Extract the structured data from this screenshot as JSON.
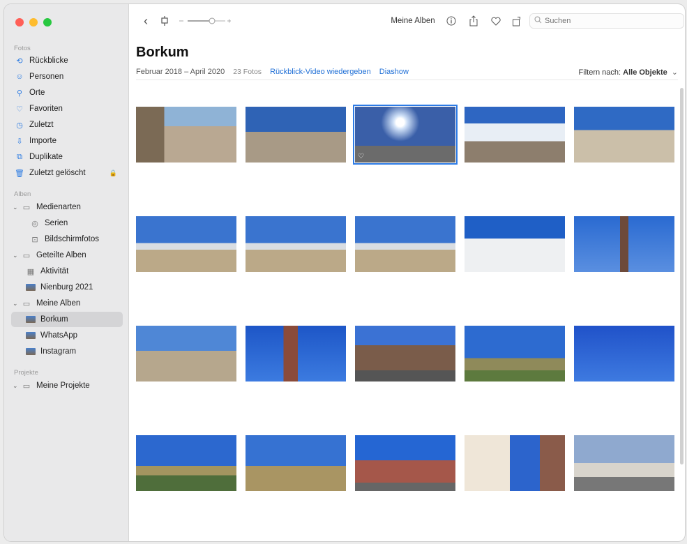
{
  "sidebar": {
    "sections": {
      "fotos": "Fotos",
      "alben": "Alben",
      "projekte": "Projekte"
    },
    "fotos_items": [
      {
        "label": "Rückblicke",
        "icon": "memories-icon"
      },
      {
        "label": "Personen",
        "icon": "people-icon"
      },
      {
        "label": "Orte",
        "icon": "places-icon"
      },
      {
        "label": "Favoriten",
        "icon": "heart-icon"
      },
      {
        "label": "Zuletzt",
        "icon": "clock-icon"
      },
      {
        "label": "Importe",
        "icon": "import-icon"
      },
      {
        "label": "Duplikate",
        "icon": "duplicates-icon"
      },
      {
        "label": "Zuletzt gelöscht",
        "icon": "trash-icon"
      }
    ],
    "alben_items": [
      {
        "label": "Medienarten",
        "icon": "folder-icon"
      },
      {
        "label": "Serien",
        "icon": "bursts-icon"
      },
      {
        "label": "Bildschirmfotos",
        "icon": "screenshot-icon"
      },
      {
        "label": "Geteilte Alben",
        "icon": "shared-folder-icon"
      },
      {
        "label": "Aktivität",
        "icon": "activity-icon"
      },
      {
        "label": "Nienburg 2021",
        "icon": "album-thumb-icon"
      },
      {
        "label": "Meine Alben",
        "icon": "folder-icon"
      },
      {
        "label": "Borkum",
        "icon": "album-thumb-icon"
      },
      {
        "label": "WhatsApp",
        "icon": "album-thumb-icon"
      },
      {
        "label": "Instagram",
        "icon": "album-thumb-icon"
      }
    ],
    "projekte_items": [
      {
        "label": "Meine Projekte",
        "icon": "folder-icon"
      }
    ]
  },
  "toolbar": {
    "back": "‹",
    "album_label": "Meine Alben",
    "search_placeholder": "Suchen"
  },
  "album": {
    "title": "Borkum",
    "date_range": "Februar 2018 – April 2020",
    "count": "23 Fotos",
    "play_memory": "Rückblick-Video wiedergeben",
    "slideshow": "Diashow",
    "filter_prefix": "Filtern nach:",
    "filter_value": "Alle Objekte"
  },
  "photos": [
    {
      "scene": "promenade",
      "fav": false
    },
    {
      "scene": "square",
      "fav": false
    },
    {
      "scene": "sun",
      "fav": true
    },
    {
      "scene": "hotel",
      "fav": false
    },
    {
      "scene": "beach-rail",
      "fav": false
    },
    {
      "scene": "beach-town",
      "fav": false
    },
    {
      "scene": "beach-town",
      "fav": false
    },
    {
      "scene": "beach-town",
      "fav": false
    },
    {
      "scene": "white-building",
      "fav": false
    },
    {
      "scene": "lighthouse-sky",
      "fav": false
    },
    {
      "scene": "sand-flat",
      "fav": false
    },
    {
      "scene": "brick-tower",
      "fav": false
    },
    {
      "scene": "street",
      "fav": false
    },
    {
      "scene": "dyke",
      "fav": false
    },
    {
      "scene": "flags",
      "fav": false
    },
    {
      "scene": "path",
      "fav": false
    },
    {
      "scene": "reeds",
      "fav": false
    },
    {
      "scene": "town-tower",
      "fav": false
    },
    {
      "scene": "facade",
      "fav": false
    },
    {
      "scene": "pavilion",
      "fav": false
    },
    {
      "scene": "partial",
      "fav": false
    },
    {
      "scene": "partial",
      "fav": false
    },
    {
      "scene": "partial",
      "fav": false
    }
  ]
}
